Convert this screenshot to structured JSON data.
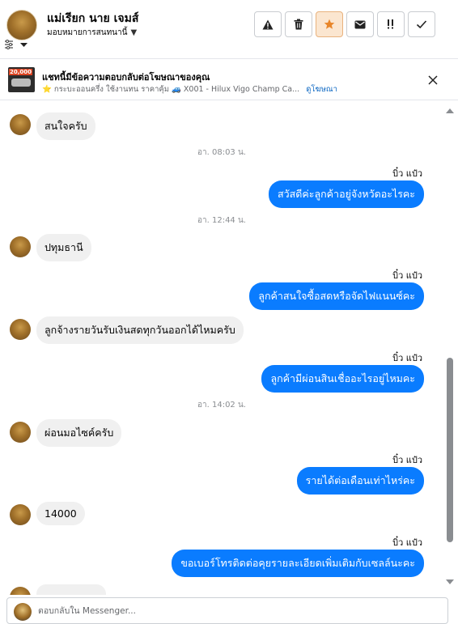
{
  "header": {
    "contact_name": "แม่เรียก นาย เจมส์",
    "assign_label": "มอบหมายการสนทนานี้",
    "buttons": [
      {
        "name": "report-button",
        "icon": "warning-icon"
      },
      {
        "name": "delete-button",
        "icon": "trash-icon"
      },
      {
        "name": "star-button",
        "icon": "star-icon"
      },
      {
        "name": "mark-unread-button",
        "icon": "envelope-icon"
      },
      {
        "name": "spam-button",
        "icon": "exclamation-icon"
      },
      {
        "name": "done-button",
        "icon": "check-icon"
      }
    ]
  },
  "ad": {
    "badge": "20,000",
    "title": "แชทนี้มีข้อความตอบกลับต่อโฆษณาของคุณ",
    "subtitle": "⭐ กระบะออนครึ่ง ใช้งานทน ราคาคุ้ม 🚙 X001 - Hilux Vigo Champ Ca...",
    "link": "ดูโฆษณา"
  },
  "messages": [
    {
      "type": "in",
      "text": "สนใจครับ"
    },
    {
      "type": "time",
      "text": "อา. 08:03 น."
    },
    {
      "type": "sender",
      "text": "บิ๋ว แป๋ว"
    },
    {
      "type": "out",
      "text": "สวัสดีค่ะลูกค้าอยู่จังหวัดอะไรคะ"
    },
    {
      "type": "time",
      "text": "อา. 12:44 น."
    },
    {
      "type": "in",
      "text": "ปทุมธานี"
    },
    {
      "type": "sender",
      "text": "บิ๋ว แป๋ว"
    },
    {
      "type": "out",
      "text": "ลูกค้าสนใจซื้อสดหรือจัดไฟแนนซ์คะ"
    },
    {
      "type": "in",
      "text": "ลูกจ้างรายวันรับเงินสดทุกวันออกได้ไหมครับ"
    },
    {
      "type": "sender",
      "text": "บิ๋ว แป๋ว"
    },
    {
      "type": "out",
      "text": "ลูกค้ามีผ่อนสินเชื่ออะไรอยู่ไหมคะ"
    },
    {
      "type": "time",
      "text": "อา. 14:02 น."
    },
    {
      "type": "in",
      "text": "ผ่อนมอไซค์ครับ"
    },
    {
      "type": "sender",
      "text": "บิ๋ว แป๋ว"
    },
    {
      "type": "out",
      "text": "รายได้ต่อเดือนเท่าไหร่คะ"
    },
    {
      "type": "in",
      "text": "14000"
    },
    {
      "type": "sender",
      "text": "บิ๋ว แป๋ว"
    },
    {
      "type": "out",
      "text": "ขอเบอร์โทรติดต่อคุยรายละเอียดเพิ่มเติมกับเซลล์นะคะ"
    }
  ],
  "composer": {
    "placeholder": "ตอบกลับใน Messenger..."
  }
}
